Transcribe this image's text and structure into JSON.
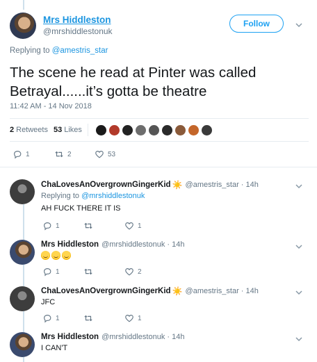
{
  "main_tweet": {
    "display_name": "Mrs Hiddleston",
    "handle": "@mrshiddlestonuk",
    "follow_label": "Follow",
    "replying_prefix": "Replying to ",
    "replying_to": "@amestris_star",
    "text_line1": "The scene he read at Pinter was called",
    "text_line2": "Betrayal......it’s gotta be theatre",
    "timestamp": "11:42 AM - 14 Nov 2018",
    "retweets_count": "2",
    "retweets_label": "Retweets",
    "likes_count": "53",
    "likes_label": "Likes",
    "liker_colors": [
      "#1a1a1a",
      "#b23a2a",
      "#222222",
      "#6d6d6d",
      "#555555",
      "#2a2a2a",
      "#8a5a3a",
      "#c4662a",
      "#3a3a3a"
    ],
    "actions": {
      "reply": "1",
      "retweet": "2",
      "like": "53"
    }
  },
  "replies": [
    {
      "name": "ChaLovesAnOvergrownGingerKid",
      "badge": "☀️",
      "meta": "@amestris_star · 14h",
      "replying_prefix": "Replying to ",
      "replying_to": "@mrshiddlestonuk",
      "text": "AH FUCK THERE IT IS",
      "actions": {
        "reply": "1",
        "retweet": "",
        "like": "1"
      }
    },
    {
      "name": "Mrs Hiddleston",
      "badge": "",
      "meta": "@mrshiddlestonuk · 14h",
      "emoji_count": 3,
      "actions": {
        "reply": "1",
        "retweet": "",
        "like": "2"
      }
    },
    {
      "name": "ChaLovesAnOvergrownGingerKid",
      "badge": "☀️",
      "meta": "@amestris_star · 14h",
      "text": "JFC",
      "actions": {
        "reply": "1",
        "retweet": "",
        "like": "1"
      }
    },
    {
      "name": "Mrs Hiddleston",
      "badge": "",
      "meta": "@mrshiddlestonuk · 14h",
      "text": "I CAN'T"
    }
  ],
  "colors": {
    "accent": "#1da1f2",
    "link": "#1b95e0",
    "muted": "#657786",
    "text": "#14171a"
  }
}
